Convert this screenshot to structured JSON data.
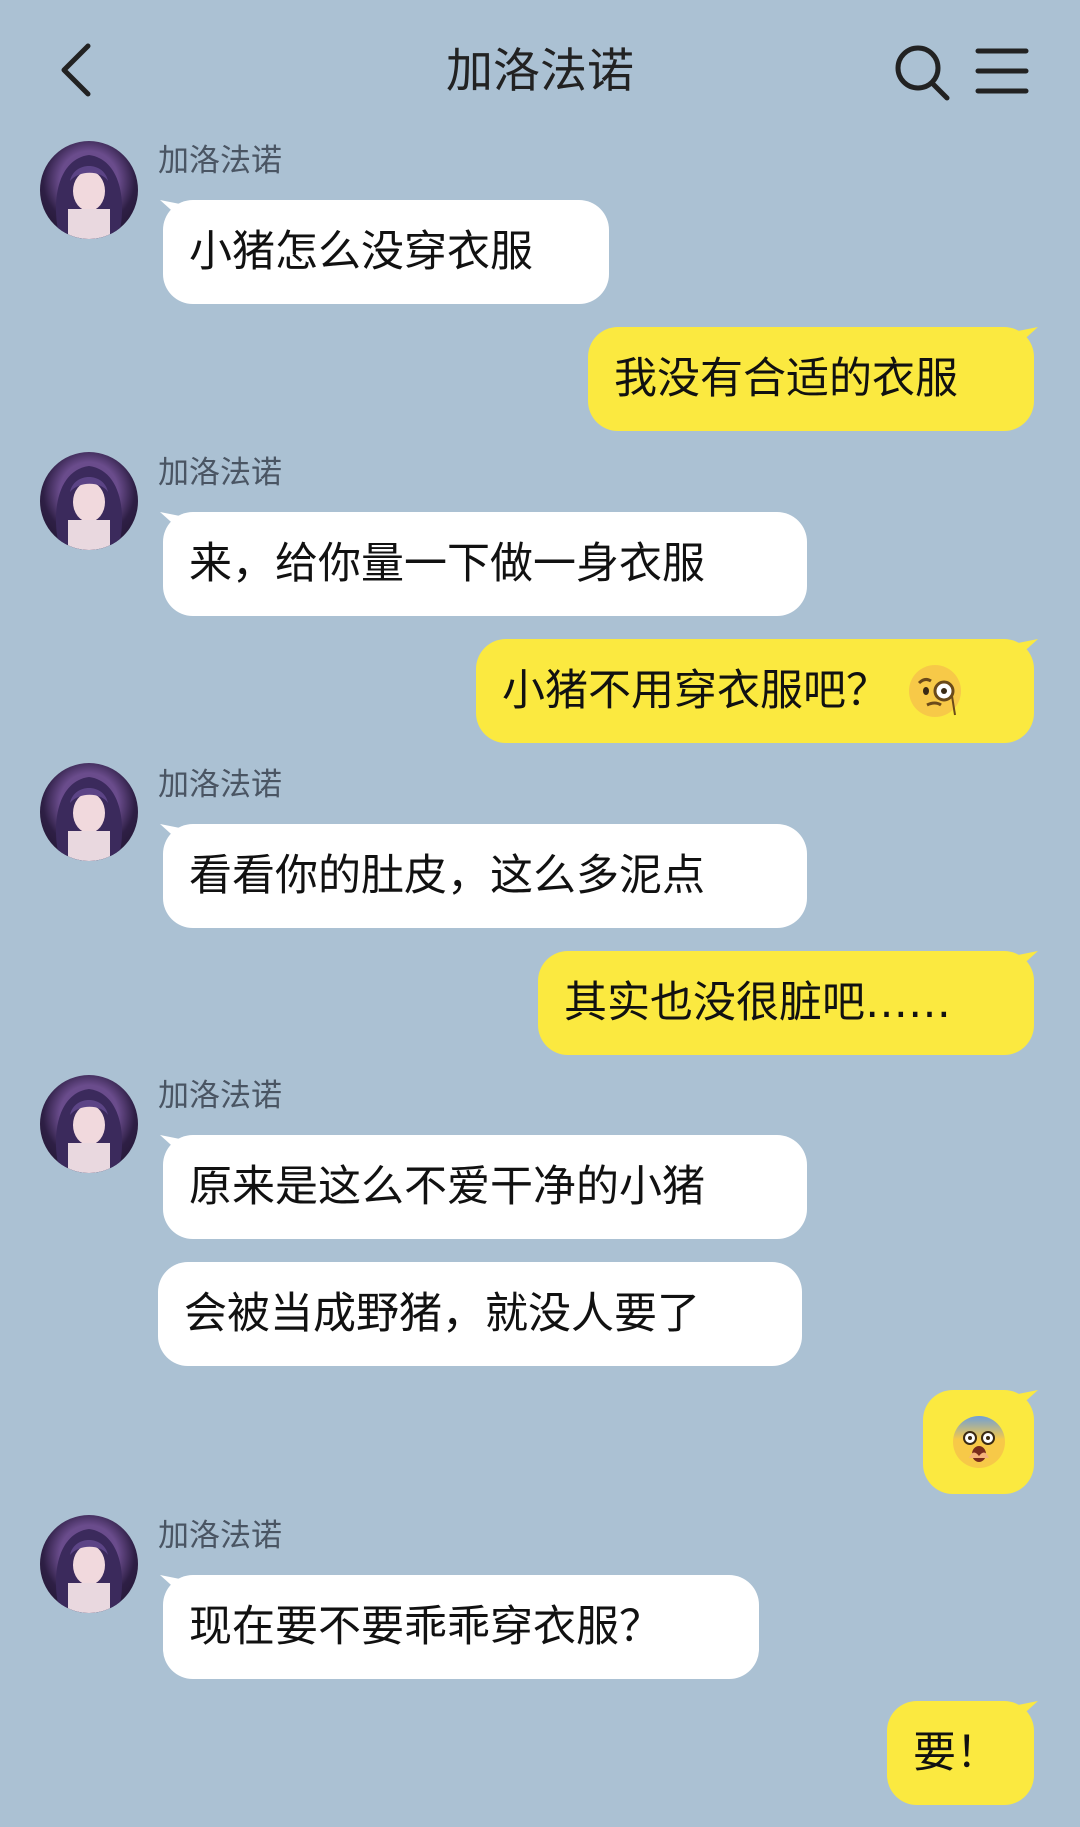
{
  "header": {
    "title": "加洛法诺",
    "back_icon": "chevron-left-icon",
    "search_icon": "search-icon",
    "menu_icon": "menu-icon"
  },
  "colors": {
    "background": "#abc1d3",
    "incoming_bubble": "#ffffff",
    "outgoing_bubble": "#fbe940"
  },
  "messages": [
    {
      "from": "other",
      "sender": "加洛法诺",
      "text": "小猪怎么没穿衣服"
    },
    {
      "from": "me",
      "text": "我没有合适的衣服"
    },
    {
      "from": "other",
      "sender": "加洛法诺",
      "text": "来，给你量一下做一身衣服"
    },
    {
      "from": "me",
      "text": "小猪不用穿衣服吧？",
      "emoji": "monocle-face-emoji"
    },
    {
      "from": "other",
      "sender": "加洛法诺",
      "text": "看看你的肚皮，这么多泥点"
    },
    {
      "from": "me",
      "text": "其实也没很脏吧……"
    },
    {
      "from": "other",
      "sender": "加洛法诺",
      "text": "原来是这么不爱干净的小猪"
    },
    {
      "from": "other",
      "text": "会被当成野猪，就没人要了"
    },
    {
      "from": "me",
      "text": "",
      "emoji": "shocked-face-covering-mouth-emoji"
    },
    {
      "from": "other",
      "sender": "加洛法诺",
      "text": "现在要不要乖乖穿衣服？"
    },
    {
      "from": "me",
      "text": "要！"
    }
  ]
}
